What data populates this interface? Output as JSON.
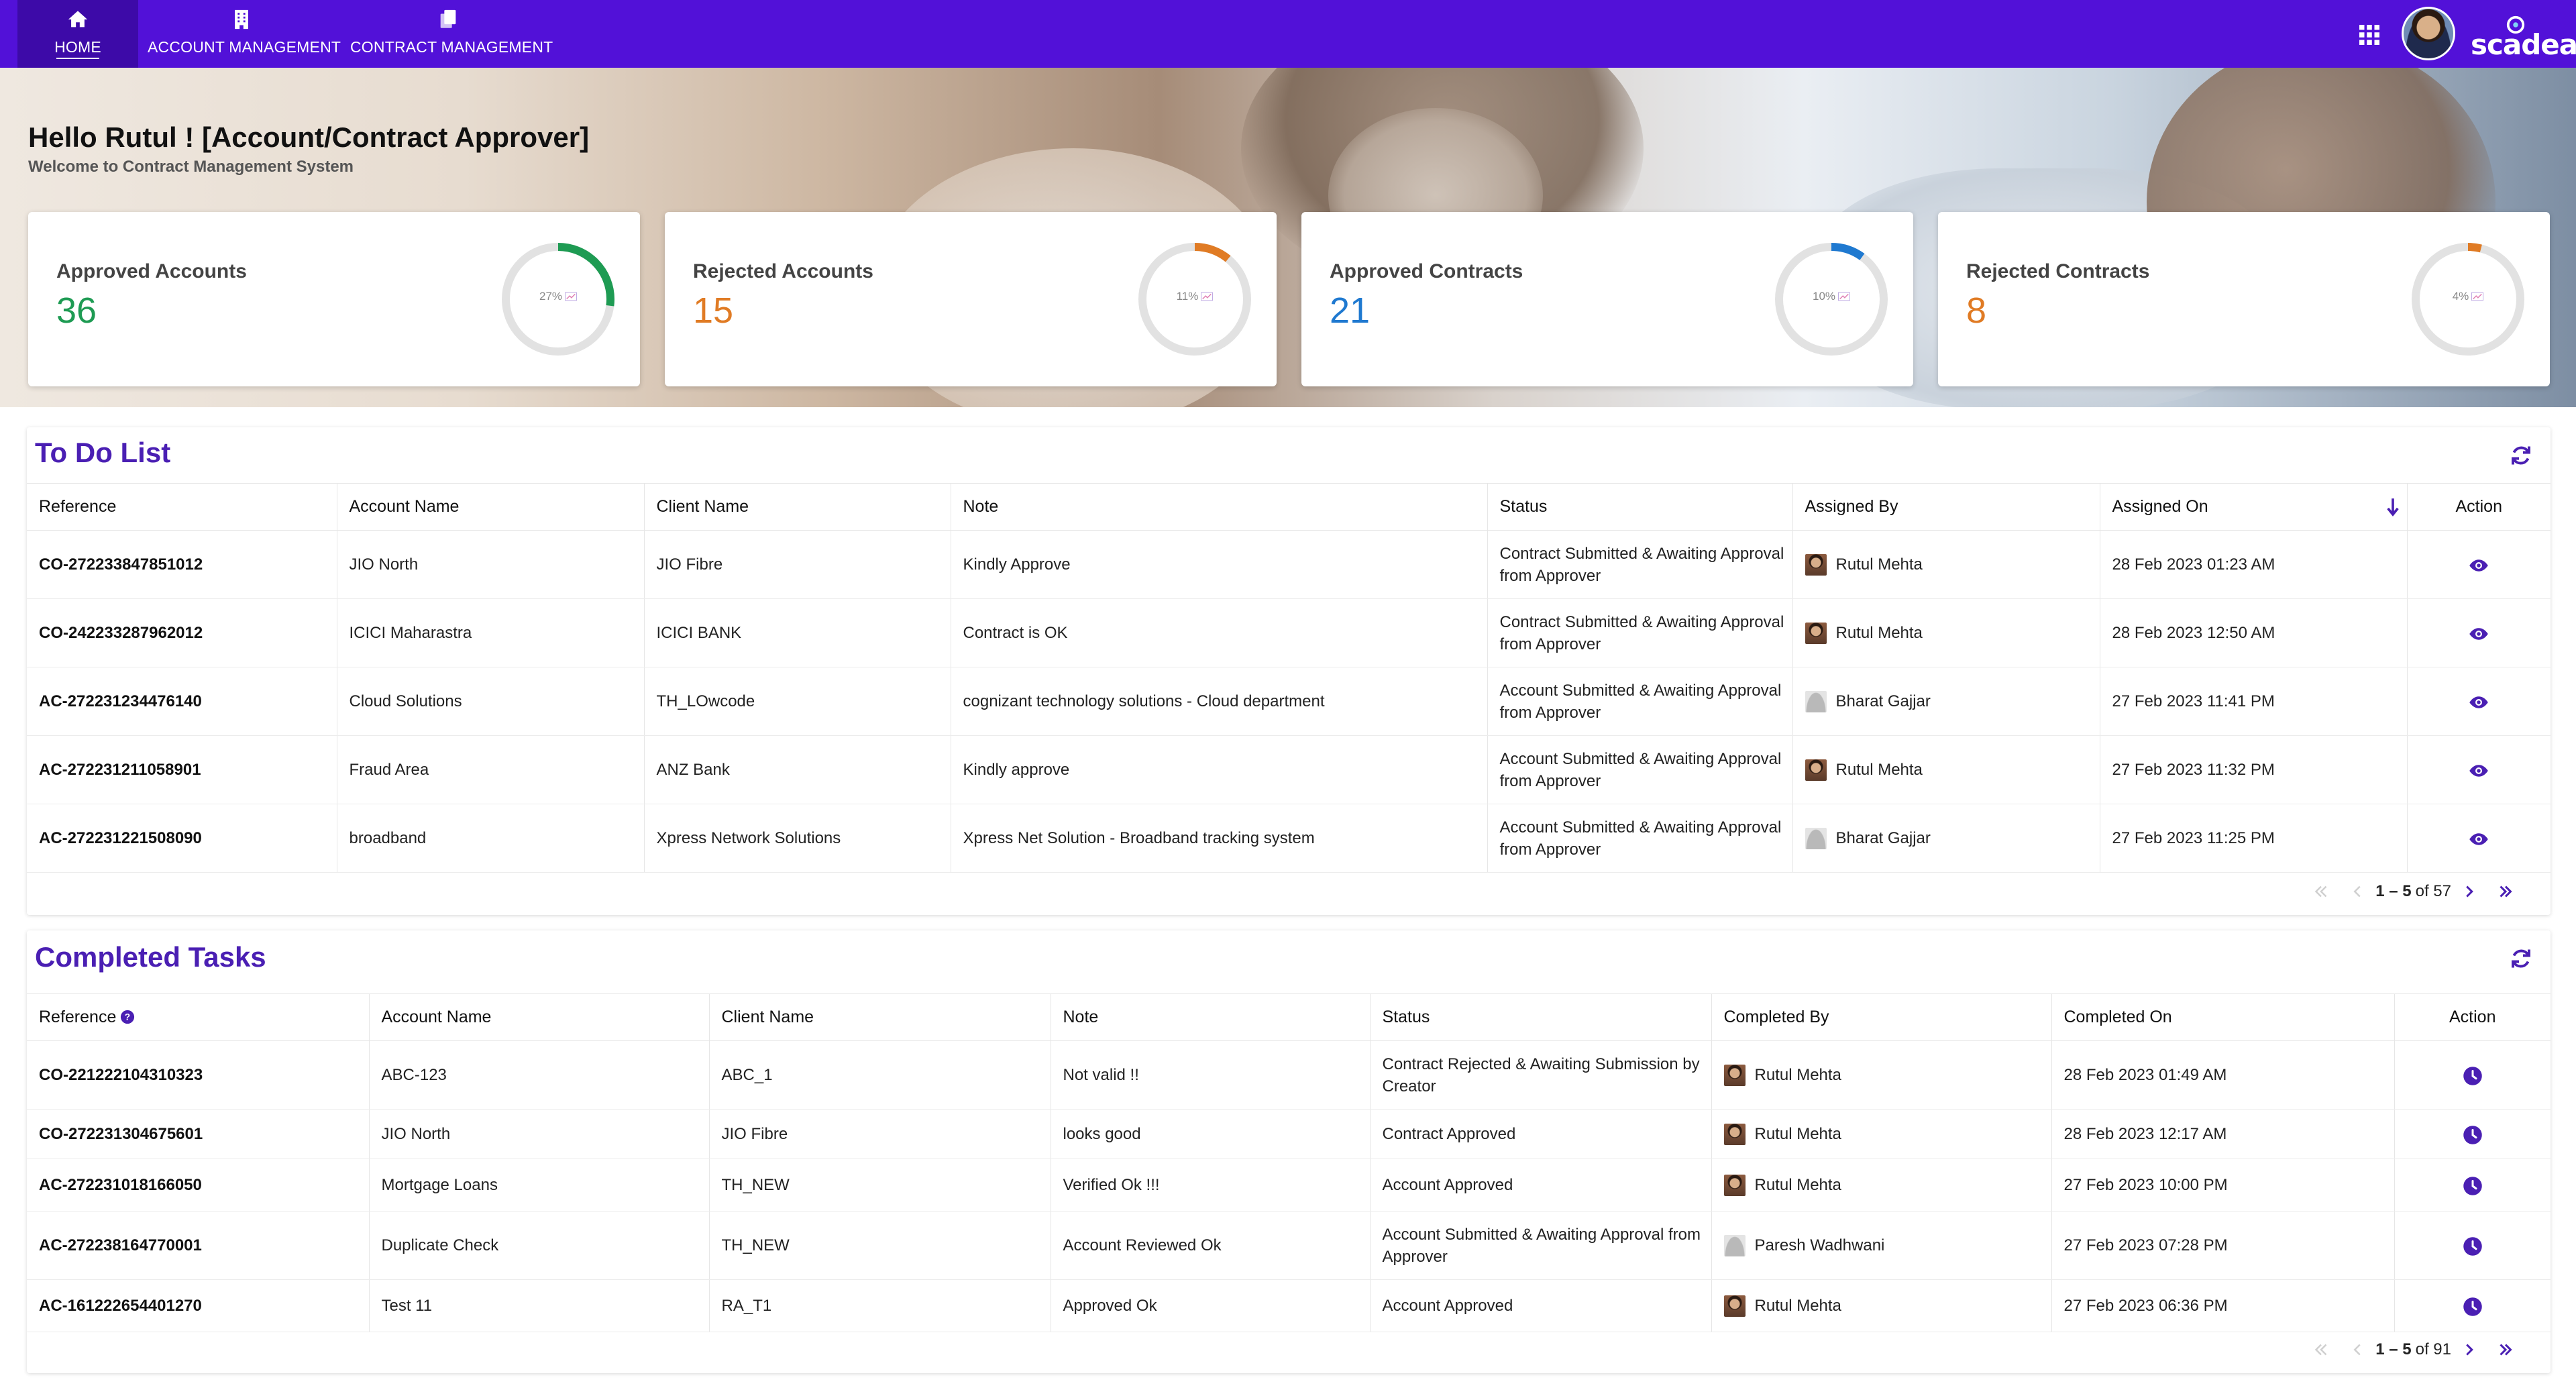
{
  "nav": {
    "home": {
      "label": "HOME",
      "icon": "home-icon"
    },
    "account_management": {
      "label": "ACCOUNT MANAGEMENT",
      "icon": "building-icon"
    },
    "contract_management": {
      "label": "CONTRACT MANAGEMENT",
      "icon": "documents-icon"
    },
    "apps_icon": "apps-grid-icon",
    "brand": "scadea"
  },
  "colors": {
    "nav_bg": "#5211d8",
    "nav_active": "#3d0aa8",
    "title": "#4a1fb3",
    "green": "#1e9b53",
    "orange": "#e07b24",
    "blue": "#1f79d0",
    "ring_track": "#e2e2e2"
  },
  "hero": {
    "greeting": "Hello Rutul ! [Account/Contract Approver]",
    "subtitle": "Welcome to Contract Management System"
  },
  "stats": [
    {
      "label": "Approved Accounts",
      "value": "36",
      "percent_label": "27%",
      "percent": 27,
      "color": "#1e9b53"
    },
    {
      "label": "Rejected Accounts",
      "value": "15",
      "percent_label": "11%",
      "percent": 11,
      "color": "#e07b24"
    },
    {
      "label": "Approved Contracts",
      "value": "21",
      "percent_label": "10%",
      "percent": 10,
      "color": "#1f79d0"
    },
    {
      "label": "Rejected Contracts",
      "value": "8",
      "percent_label": "4%",
      "percent": 4,
      "color": "#e07b24"
    }
  ],
  "todo": {
    "title": "To Do List",
    "columns": [
      "Reference",
      "Account Name",
      "Client Name",
      "Note",
      "Status",
      "Assigned By",
      "Assigned On",
      "Action"
    ],
    "rows": [
      {
        "reference": "CO-272233847851012",
        "account": "JIO North",
        "client": "JIO Fibre",
        "note": "Kindly Approve",
        "status": "Contract Submitted & Awaiting Approval from Approver",
        "by": "Rutul Mehta",
        "avatar": "photo",
        "on": "28 Feb 2023 01:23 AM"
      },
      {
        "reference": "CO-242233287962012",
        "account": "ICICI Maharastra",
        "client": "ICICI BANK",
        "note": "Contract is OK",
        "status": "Contract Submitted & Awaiting Approval from Approver",
        "by": "Rutul Mehta",
        "avatar": "photo",
        "on": "28 Feb 2023 12:50 AM"
      },
      {
        "reference": "AC-272231234476140",
        "account": "Cloud Solutions",
        "client": "TH_LOwcode",
        "note": "cognizant technology solutions - Cloud department",
        "status": "Account Submitted & Awaiting Approval from Approver",
        "by": "Bharat Gajjar",
        "avatar": "blank",
        "on": "27 Feb 2023 11:41 PM"
      },
      {
        "reference": "AC-272231211058901",
        "account": "Fraud Area",
        "client": "ANZ Bank",
        "note": "Kindly approve",
        "status": "Account Submitted & Awaiting Approval from Approver",
        "by": "Rutul Mehta",
        "avatar": "photo",
        "on": "27 Feb 2023 11:32 PM"
      },
      {
        "reference": "AC-272231221508090",
        "account": "broadband",
        "client": "Xpress Network Solutions",
        "note": "Xpress Net Solution - Broadband tracking system",
        "status": "Account Submitted & Awaiting Approval from Approver",
        "by": "Bharat Gajjar",
        "avatar": "blank",
        "on": "27 Feb 2023 11:25 PM"
      }
    ],
    "pager": {
      "range": "1 – 5",
      "of": "of 57"
    }
  },
  "completed": {
    "title": "Completed Tasks",
    "columns": [
      "Reference",
      "Account Name",
      "Client Name",
      "Note",
      "Status",
      "Completed By",
      "Completed On",
      "Action"
    ],
    "rows": [
      {
        "reference": "CO-221222104310323",
        "account": "ABC-123",
        "client": "ABC_1",
        "note": "Not valid !!",
        "status": "Contract Rejected & Awaiting Submission by Creator",
        "by": "Rutul Mehta",
        "avatar": "photo",
        "on": "28 Feb 2023 01:49 AM"
      },
      {
        "reference": "CO-272231304675601",
        "account": "JIO North",
        "client": "JIO Fibre",
        "note": "looks good",
        "status": "Contract Approved",
        "by": "Rutul Mehta",
        "avatar": "photo",
        "on": "28 Feb 2023 12:17 AM"
      },
      {
        "reference": "AC-272231018166050",
        "account": "Mortgage Loans",
        "client": "TH_NEW",
        "note": "Verified Ok !!!",
        "status": "Account Approved",
        "by": "Rutul Mehta",
        "avatar": "photo",
        "on": "27 Feb 2023 10:00 PM"
      },
      {
        "reference": "AC-272238164770001",
        "account": "Duplicate Check",
        "client": "TH_NEW",
        "note": "Account Reviewed Ok",
        "status": "Account Submitted & Awaiting Approval from Approver",
        "by": "Paresh Wadhwani",
        "avatar": "blank",
        "on": "27 Feb 2023 07:28 PM"
      },
      {
        "reference": "AC-161222654401270",
        "account": "Test 11",
        "client": "RA_T1",
        "note": "Approved Ok",
        "status": "Account Approved",
        "by": "Rutul Mehta",
        "avatar": "photo",
        "on": "27 Feb 2023 06:36 PM"
      }
    ],
    "pager": {
      "range": "1 – 5",
      "of": "of 91"
    }
  }
}
